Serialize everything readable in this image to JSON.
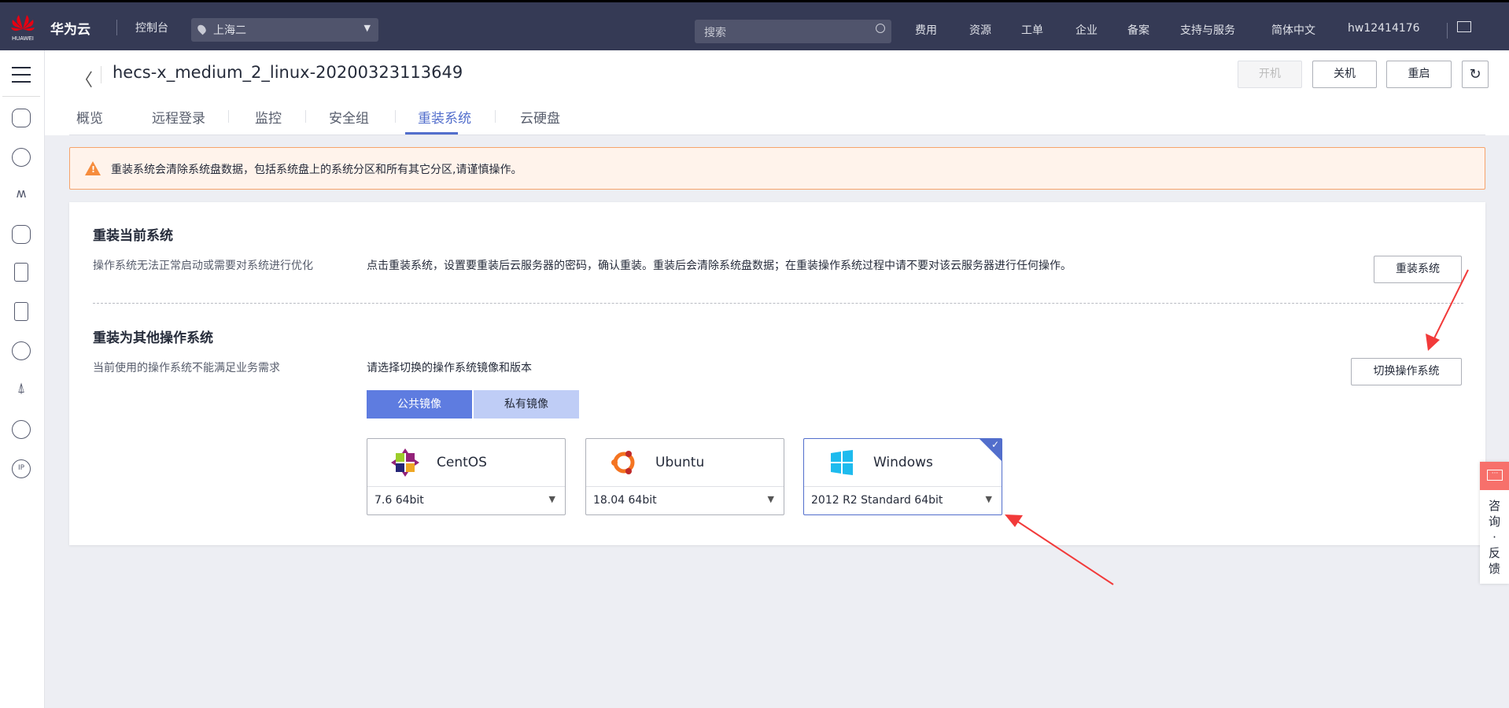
{
  "topbar": {
    "logo_text": "HUAWEI",
    "brand": "华为云",
    "console": "控制台",
    "region": "上海二",
    "search_placeholder": "搜索",
    "nav": [
      "费用",
      "资源",
      "工单",
      "企业",
      "备案",
      "支持与服务",
      "简体中文",
      "hw12414176"
    ]
  },
  "header": {
    "title": "hecs-x_medium_2_linux-20200323113649",
    "buttons": {
      "start": "开机",
      "stop": "关机",
      "restart": "重启"
    },
    "tabs": [
      "概览",
      "远程登录",
      "监控",
      "安全组",
      "重装系统",
      "云硬盘"
    ],
    "active_tab": "重装系统"
  },
  "warning": "重装系统会清除系统盘数据，包括系统盘上的系统分区和所有其它分区,请谨慎操作。",
  "section1": {
    "title": "重装当前系统",
    "left_desc": "操作系统无法正常启动或需要对系统进行优化",
    "right_desc": "点击重装系统，设置要重装后云服务器的密码，确认重装。重装后会清除系统盘数据；在重装操作系统过程中请不要对该云服务器进行任何操作。",
    "button": "重装系统"
  },
  "section2": {
    "title": "重装为其他操作系统",
    "left_desc": "当前使用的操作系统不能满足业务需求",
    "right_desc": "请选择切换的操作系统镜像和版本",
    "button": "切换操作系统",
    "image_tabs": [
      "公共镜像",
      "私有镜像"
    ],
    "active_image_tab": "公共镜像",
    "os": [
      {
        "name": "CentOS",
        "version": "7.6 64bit",
        "selected": false
      },
      {
        "name": "Ubuntu",
        "version": "18.04 64bit",
        "selected": false
      },
      {
        "name": "Windows",
        "version": "2012 R2 Standard 64bit",
        "selected": true
      }
    ],
    "check": "✓"
  },
  "float": {
    "label": [
      "咨",
      "询",
      "·",
      "反",
      "馈"
    ]
  },
  "colors": {
    "accent": "#526ecc",
    "topbar": "#353a55",
    "warning": "#f68c3d",
    "arrow": "#f23a3a"
  }
}
